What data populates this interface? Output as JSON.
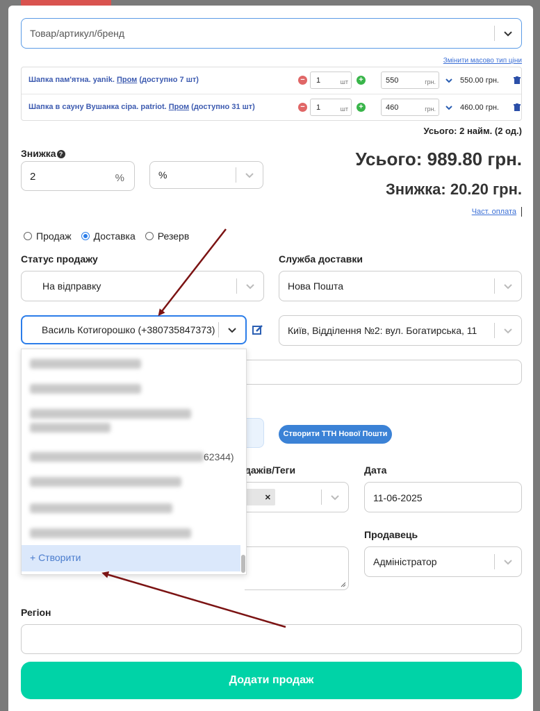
{
  "search": {
    "placeholder": "Товар/артикул/бренд"
  },
  "bulk_price_link": "Змінити масово тип ціни",
  "products": [
    {
      "name": "Шапка пам'ятна. yanik.",
      "source": "Пром",
      "avail": "(доступно 7 шт)",
      "qty": "1",
      "unit": "шт",
      "price": "550",
      "currency": "грн.",
      "total": "550.00 грн."
    },
    {
      "name": "Шапка в сауну Вушанка сіра. patriot.",
      "source": "Пром",
      "avail": "(доступно 31 шт)",
      "qty": "1",
      "unit": "шт",
      "price": "460",
      "currency": "грн.",
      "total": "460.00 грн."
    }
  ],
  "summary_count": "Усього: 2 найм. (2 од.)",
  "discount": {
    "label": "Знижка",
    "value": "2",
    "unit": "%",
    "type": "%"
  },
  "totals": {
    "total": "Усього: 989.80 грн.",
    "discount": "Знижка: 20.20 грн.",
    "partial_link": "Част. оплата"
  },
  "order_type": {
    "options": [
      "Продаж",
      "Доставка",
      "Резерв"
    ],
    "selected": "Доставка"
  },
  "sale_status": {
    "label": "Статус продажу",
    "value": "На відправку"
  },
  "delivery": {
    "label": "Служба доставки",
    "value": "Нова Пошта",
    "branch": "Київ, Відділення №2: вул. Богатирська, 11"
  },
  "customer": {
    "value": "Василь Котигорошко (+380735847373)"
  },
  "customer_dropdown": {
    "partial_visible": "62344)",
    "create_label": "+ Створити"
  },
  "ttn_button": "Створити ТТН Нової Пошти",
  "tags": {
    "label": "дажів/Теги"
  },
  "date": {
    "label": "Дата",
    "value": "11-06-2025"
  },
  "seller": {
    "label": "Продавець",
    "value": "Адміністратор"
  },
  "region": {
    "label": "Регіон"
  },
  "submit": "Додати продаж",
  "colors": {
    "accent": "#00d3a7",
    "link": "#3b6fd6",
    "arrow": "#7b1313"
  }
}
